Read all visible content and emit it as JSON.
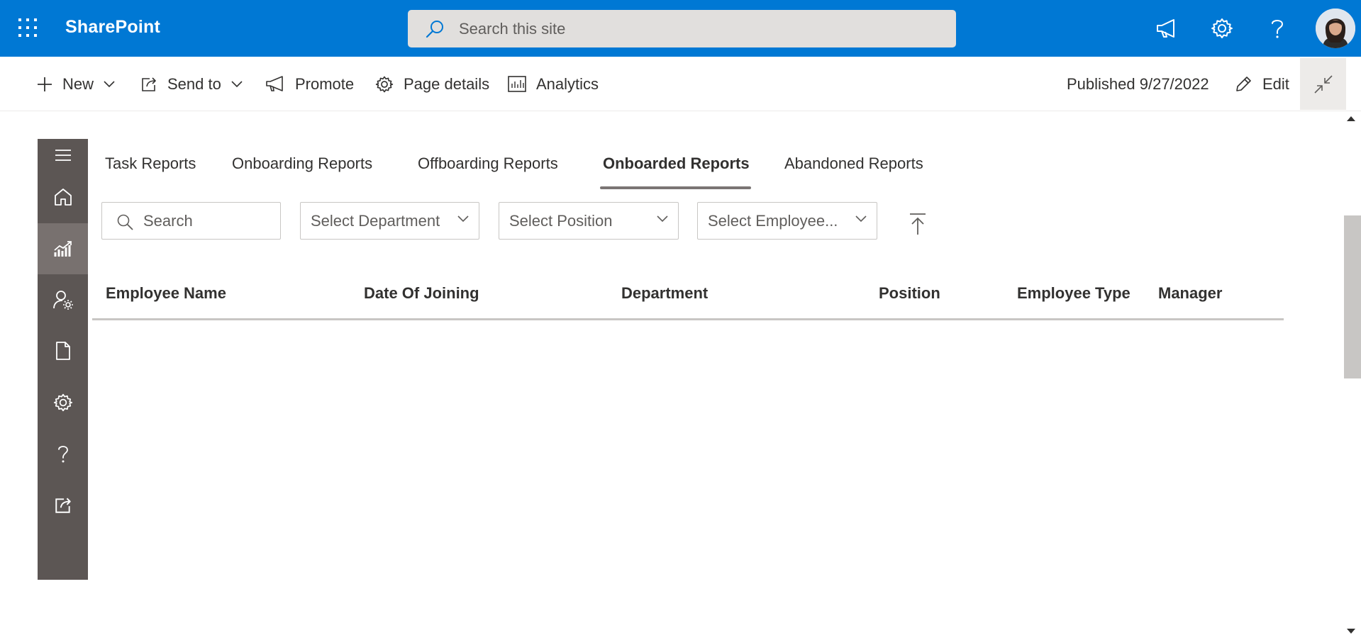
{
  "suitebar": {
    "brand": "SharePoint",
    "search_placeholder": "Search this site"
  },
  "commandbar": {
    "new_label": "New",
    "send_to_label": "Send to",
    "promote_label": "Promote",
    "page_details_label": "Page details",
    "analytics_label": "Analytics",
    "published_label": "Published 9/27/2022",
    "edit_label": "Edit"
  },
  "leftnav": {
    "items": [
      "menu-icon",
      "home-icon",
      "analytics-icon",
      "user-settings-icon",
      "document-icon",
      "gear-icon",
      "help-icon",
      "share-icon"
    ],
    "active_index": 2
  },
  "tabs": [
    {
      "label": "Task Reports"
    },
    {
      "label": "Onboarding Reports"
    },
    {
      "label": "Offboarding Reports"
    },
    {
      "label": "Onboarded Reports",
      "active": true
    },
    {
      "label": "Abandoned Reports"
    }
  ],
  "filters": {
    "search_placeholder": "Search",
    "department": "Select Department",
    "position": "Select Position",
    "employee": "Select Employee..."
  },
  "table": {
    "columns": [
      "Employee Name",
      "Date Of Joining",
      "Department",
      "Position",
      "Employee Type",
      "Manager"
    ],
    "rows": []
  },
  "colors": {
    "suitebar": "#0078d4",
    "leftnav": "#5c5654",
    "leftnav_active": "#78716f"
  }
}
